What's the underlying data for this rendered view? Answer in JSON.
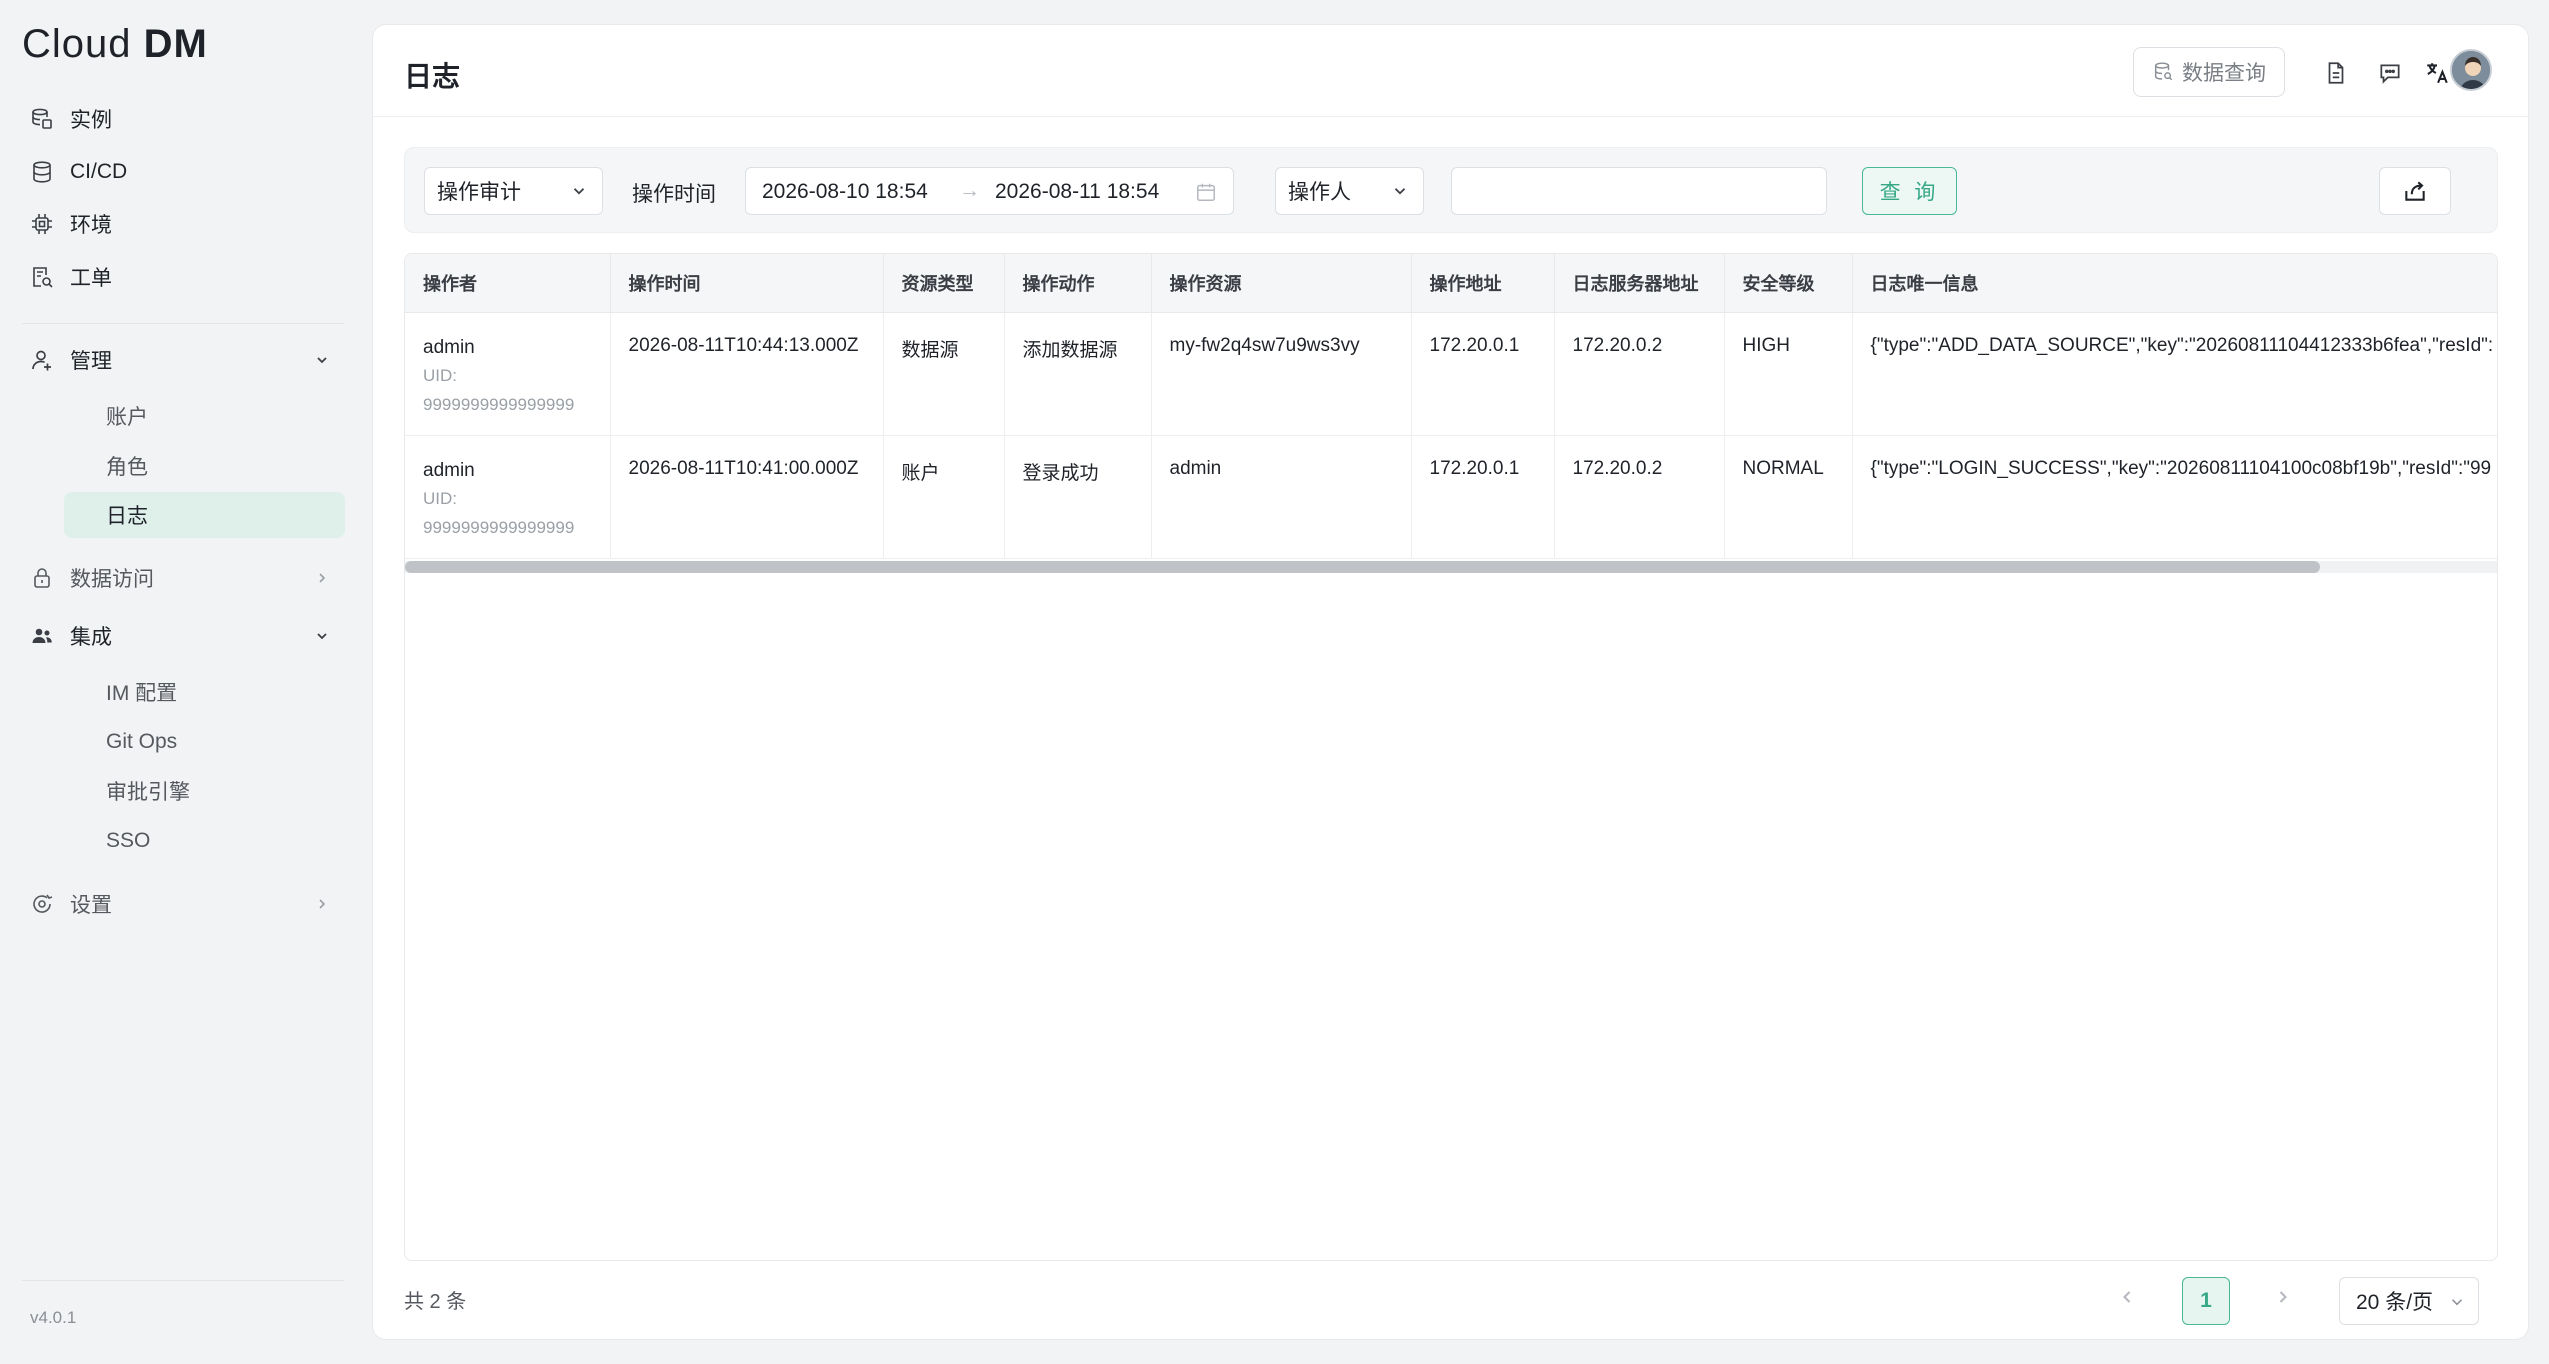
{
  "app": {
    "logo_light": "Cl",
    "logo_o": "o",
    "logo_rest": "ud ",
    "logo_bold": "DM",
    "version": "v4.0.1"
  },
  "sidebar": {
    "items": [
      {
        "label": "实例",
        "icon": "database-stack-icon"
      },
      {
        "label": "CI/CD",
        "icon": "database-icon"
      },
      {
        "label": "环境",
        "icon": "chip-icon"
      },
      {
        "label": "工单",
        "icon": "ticket-search-icon"
      }
    ],
    "admin": {
      "label": "管理",
      "icon": "user-manage-icon",
      "expanded": true,
      "children": [
        "账户",
        "角色",
        "日志"
      ],
      "active": "日志"
    },
    "data_access": {
      "label": "数据访问",
      "icon": "lock-icon",
      "expanded": false
    },
    "integration": {
      "label": "集成",
      "icon": "team-icon",
      "expanded": true,
      "children": [
        "IM 配置",
        "Git Ops",
        "审批引擎",
        "SSO"
      ]
    },
    "settings": {
      "label": "设置",
      "icon": "settings-icon",
      "expanded": false
    }
  },
  "header": {
    "title": "日志",
    "query_data_label": "数据查询",
    "icons": [
      "document-icon",
      "message-icon",
      "translate-icon",
      "avatar"
    ]
  },
  "filters": {
    "type_select": "操作审计",
    "time_label": "操作时间",
    "date_start": "2026-08-10 18:54",
    "date_arrow": "→",
    "date_end": "2026-08-11 18:54",
    "operator_select": "操作人",
    "keyword_value": "",
    "search_label": "查 询"
  },
  "table": {
    "columns": [
      "操作者",
      "操作时间",
      "资源类型",
      "操作动作",
      "操作资源",
      "操作地址",
      "日志服务器地址",
      "安全等级",
      "日志唯一信息"
    ],
    "rows": [
      {
        "operator": "admin",
        "uid": "UID: 9999999999999999",
        "time": "2026-08-11T10:44:13.000Z",
        "resource_type": "数据源",
        "action": "添加数据源",
        "resource": "my-fw2q4sw7u9ws3vy",
        "address": "172.20.0.1",
        "log_server": "172.20.0.2",
        "level": "HIGH",
        "info": "{\"type\":\"ADD_DATA_SOURCE\",\"key\":\"20260811104412333b6fea\",\"resId\":"
      },
      {
        "operator": "admin",
        "uid": "UID: 9999999999999999",
        "time": "2026-08-11T10:41:00.000Z",
        "resource_type": "账户",
        "action": "登录成功",
        "resource": "admin",
        "address": "172.20.0.1",
        "log_server": "172.20.0.2",
        "level": "NORMAL",
        "info": "{\"type\":\"LOGIN_SUCCESS\",\"key\":\"20260811104100c08bf19b\",\"resId\":\"99"
      }
    ]
  },
  "footer": {
    "total": "共 2 条",
    "current_page": "1",
    "page_size": "20 条/页"
  },
  "colors": {
    "accent": "#36a886",
    "active_bg": "#dff0eb"
  }
}
